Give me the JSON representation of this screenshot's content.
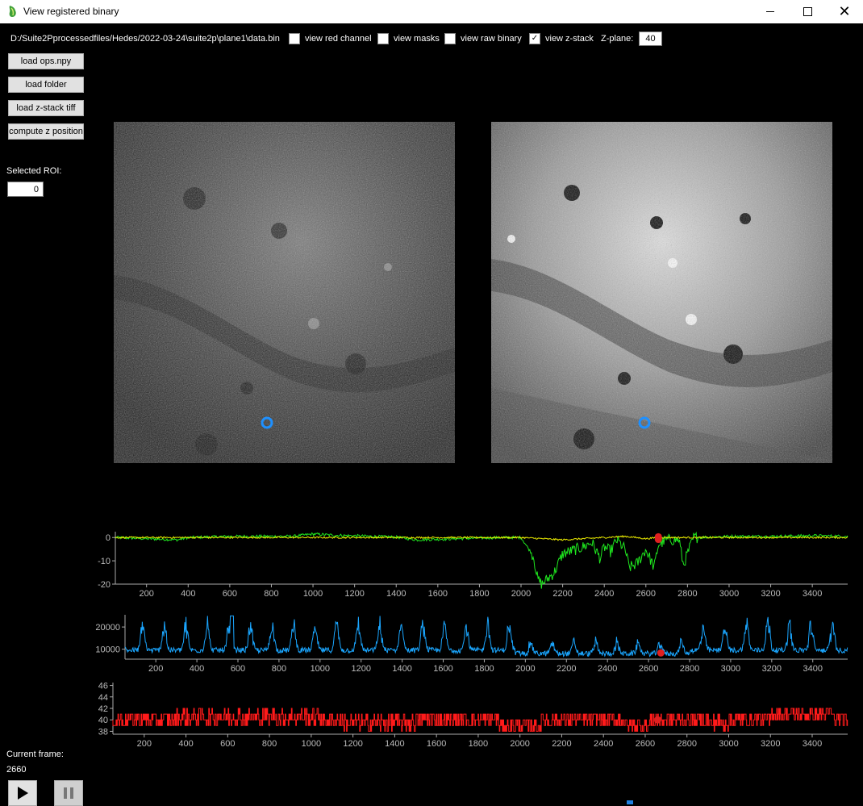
{
  "window": {
    "title": "View registered binary",
    "close_glyph": "✕"
  },
  "toolbar": {
    "file_path": "D:/Suite2Pprocessedfiles/Hedes/2022-03-24\\suite2p\\plane1\\data.bin",
    "checkboxes": [
      {
        "label": "view red channel",
        "checked": false
      },
      {
        "label": "view masks",
        "checked": false
      },
      {
        "label": "view raw binary",
        "checked": false
      },
      {
        "label": "view z-stack",
        "checked": true
      }
    ],
    "zplane_label": "Z-plane:",
    "zplane_value": "40"
  },
  "sidebar": {
    "buttons": [
      "load ops.npy",
      "load folder",
      "load z-stack tiff",
      "compute z position"
    ],
    "roi_label": "Selected ROI:",
    "roi_value": "0"
  },
  "playback": {
    "current_frame_label": "Current frame:",
    "current_frame": 2660
  },
  "colors": {
    "green": "#1fe81f",
    "yellow": "#f0f000",
    "blue": "#1aa6ff",
    "red": "#ff1a1a",
    "marker": "#e02020",
    "roi": "#1e90ff"
  },
  "chart_data": [
    {
      "type": "line",
      "x_ticks": [
        200,
        400,
        600,
        800,
        1000,
        1200,
        1400,
        1600,
        1800,
        2000,
        2200,
        2400,
        2600,
        2800,
        3000,
        3200,
        3400
      ],
      "xlim": [
        50,
        3570
      ],
      "y_ticks": [
        0,
        -10,
        -20
      ],
      "ylim": [
        -20,
        2.5
      ],
      "marker_frame": 2660,
      "series": [
        {
          "color": "green",
          "segments": [
            [
              50,
              0
            ],
            [
              200,
              -0.5
            ],
            [
              350,
              -1
            ],
            [
              400,
              0
            ],
            [
              600,
              0.5
            ],
            [
              900,
              0.5
            ],
            [
              1000,
              1.5
            ],
            [
              1100,
              1
            ],
            [
              1400,
              0.2
            ],
            [
              1500,
              -1
            ],
            [
              1900,
              0
            ],
            [
              2000,
              0
            ],
            [
              2060,
              -8
            ],
            [
              2080,
              -18
            ],
            [
              2100,
              -20
            ],
            [
              2160,
              -15
            ],
            [
              2200,
              -7
            ],
            [
              2300,
              -4
            ],
            [
              2340,
              -2
            ],
            [
              2380,
              -9
            ],
            [
              2400,
              -4
            ],
            [
              2430,
              -6
            ],
            [
              2460,
              -1
            ],
            [
              2500,
              -5
            ],
            [
              2520,
              -13
            ],
            [
              2560,
              -11
            ],
            [
              2600,
              -5
            ],
            [
              2640,
              -13
            ],
            [
              2660,
              -3
            ],
            [
              2700,
              -1
            ],
            [
              2760,
              -1
            ],
            [
              2780,
              -12
            ],
            [
              2800,
              -7
            ],
            [
              2830,
              0
            ],
            [
              3000,
              0.5
            ],
            [
              3200,
              0.5
            ],
            [
              3400,
              0.8
            ],
            [
              3570,
              0.5
            ]
          ]
        },
        {
          "color": "yellow",
          "segments": [
            [
              50,
              0
            ],
            [
              2000,
              0
            ],
            [
              2100,
              -0.5
            ],
            [
              2200,
              -1
            ],
            [
              2300,
              -0.5
            ],
            [
              2400,
              0
            ],
            [
              2500,
              0.5
            ],
            [
              2600,
              -0.5
            ],
            [
              2660,
              0
            ],
            [
              3570,
              0
            ]
          ]
        }
      ]
    },
    {
      "type": "line",
      "x_ticks": [
        200,
        400,
        600,
        800,
        1000,
        1200,
        1400,
        1600,
        1800,
        2000,
        2200,
        2400,
        2600,
        2800,
        3000,
        3200,
        3400
      ],
      "xlim": [
        50,
        3570
      ],
      "y_ticks": [
        10000,
        20000
      ],
      "ylim": [
        5500,
        25500
      ],
      "marker_frame": 2660,
      "marker_value": 8300
    },
    {
      "type": "line",
      "x_ticks": [
        200,
        400,
        600,
        800,
        1000,
        1200,
        1400,
        1600,
        1800,
        2000,
        2200,
        2400,
        2600,
        2800,
        3000,
        3200,
        3400
      ],
      "xlim": [
        50,
        3570
      ],
      "y_ticks": [
        38,
        40,
        42,
        44,
        46
      ],
      "ylim": [
        37.5,
        46.5
      ],
      "marker_frame": 2660,
      "marker_value": 40
    }
  ]
}
